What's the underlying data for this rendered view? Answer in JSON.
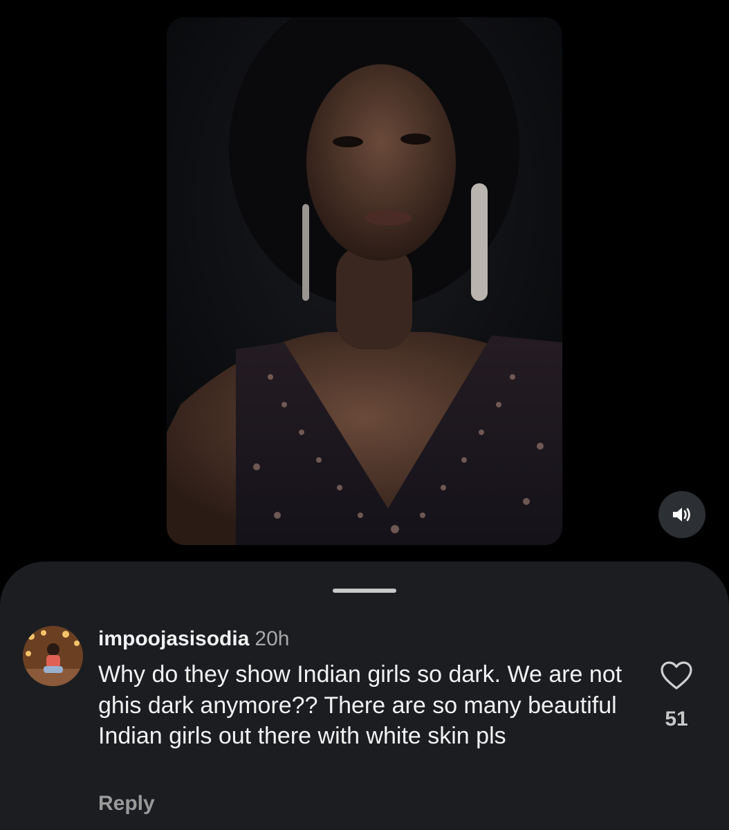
{
  "video": {
    "mute_icon": "speaker-on-icon"
  },
  "comment": {
    "username": "impoojasisodia",
    "time": "20h",
    "text": "Why do they show Indian girls so dark. We are not ghis dark anymore?? There are so many beautiful Indian girls out there with white skin pls",
    "reply_label": "Reply",
    "like_count": "51",
    "like_icon": "heart-outline-icon"
  },
  "colors": {
    "background": "#000000",
    "sheet": "#1b1d21",
    "primary_text": "#f2f2f2",
    "secondary_text": "#a8a8a8"
  }
}
